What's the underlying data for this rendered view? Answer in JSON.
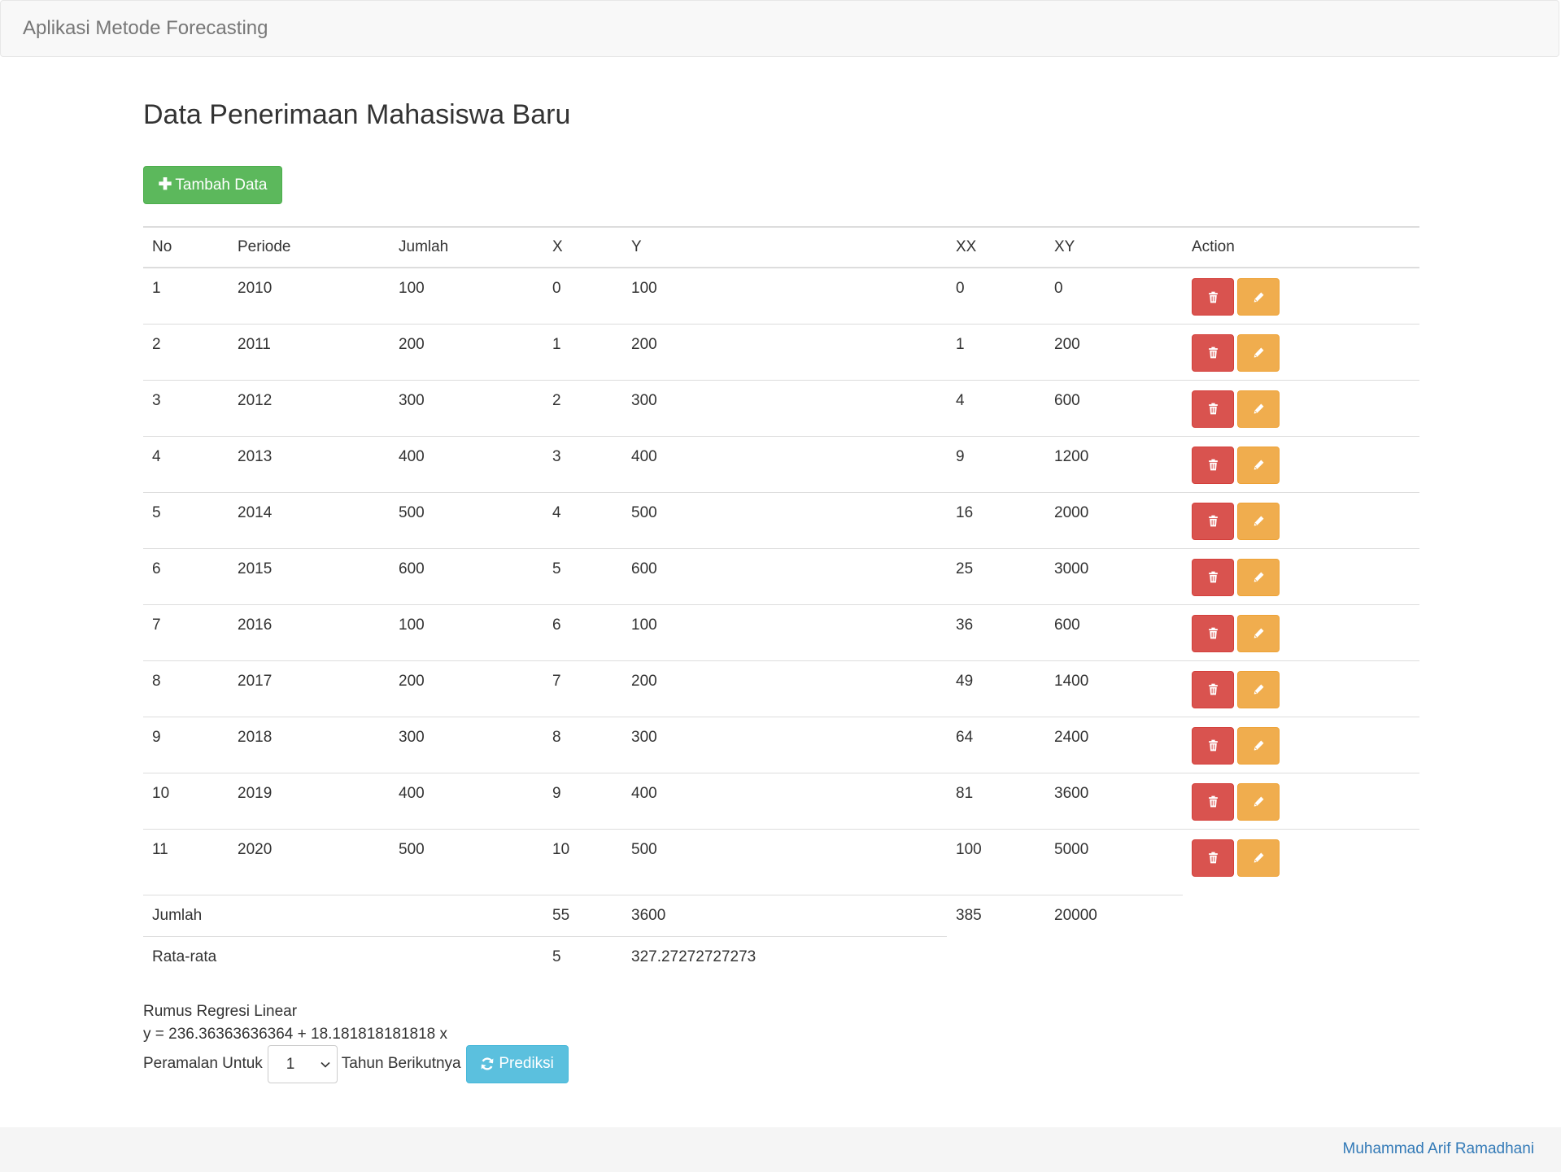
{
  "navbar": {
    "brand": "Aplikasi Metode Forecasting"
  },
  "page_title": "Data Penerimaan Mahasiswa Baru",
  "add_button": {
    "label": "Tambah Data",
    "icon": "plus-icon"
  },
  "table": {
    "columns": [
      "No",
      "Periode",
      "Jumlah",
      "X",
      "Y",
      "XX",
      "XY",
      "Action"
    ],
    "rows": [
      [
        "1",
        "2010",
        "100",
        "0",
        "100",
        "0",
        "0"
      ],
      [
        "2",
        "2011",
        "200",
        "1",
        "200",
        "1",
        "200"
      ],
      [
        "3",
        "2012",
        "300",
        "2",
        "300",
        "4",
        "600"
      ],
      [
        "4",
        "2013",
        "400",
        "3",
        "400",
        "9",
        "1200"
      ],
      [
        "5",
        "2014",
        "500",
        "4",
        "500",
        "16",
        "2000"
      ],
      [
        "6",
        "2015",
        "600",
        "5",
        "600",
        "25",
        "3000"
      ],
      [
        "7",
        "2016",
        "100",
        "6",
        "100",
        "36",
        "600"
      ],
      [
        "8",
        "2017",
        "200",
        "7",
        "200",
        "49",
        "1400"
      ],
      [
        "9",
        "2018",
        "300",
        "8",
        "300",
        "64",
        "2400"
      ],
      [
        "10",
        "2019",
        "400",
        "9",
        "400",
        "81",
        "3600"
      ],
      [
        "11",
        "2020",
        "500",
        "10",
        "500",
        "100",
        "5000"
      ]
    ],
    "action_icons": {
      "delete": "trash-icon",
      "edit": "pencil-icon"
    }
  },
  "summary": {
    "total": {
      "label": "Jumlah",
      "x": "55",
      "y": "3600",
      "xx": "385",
      "xy": "20000"
    },
    "average": {
      "label": "Rata-rata",
      "x": "5",
      "y": "327.27272727273"
    }
  },
  "formula": {
    "title": "Rumus Regresi Linear",
    "equation": "y = 236.36363636364 + 18.181818181818 x"
  },
  "prediction": {
    "prefix": "Peramalan Untuk",
    "selected_value": "1",
    "suffix": "Tahun Berikutnya",
    "button_label": "Prediksi",
    "button_icon": "refresh-icon"
  },
  "footer": {
    "author": "Muhammad Arif Ramadhani"
  },
  "colors": {
    "success": "#5cb85c",
    "danger": "#d9534f",
    "warning": "#f0ad4e",
    "info": "#5bc0de",
    "link": "#337ab7"
  }
}
